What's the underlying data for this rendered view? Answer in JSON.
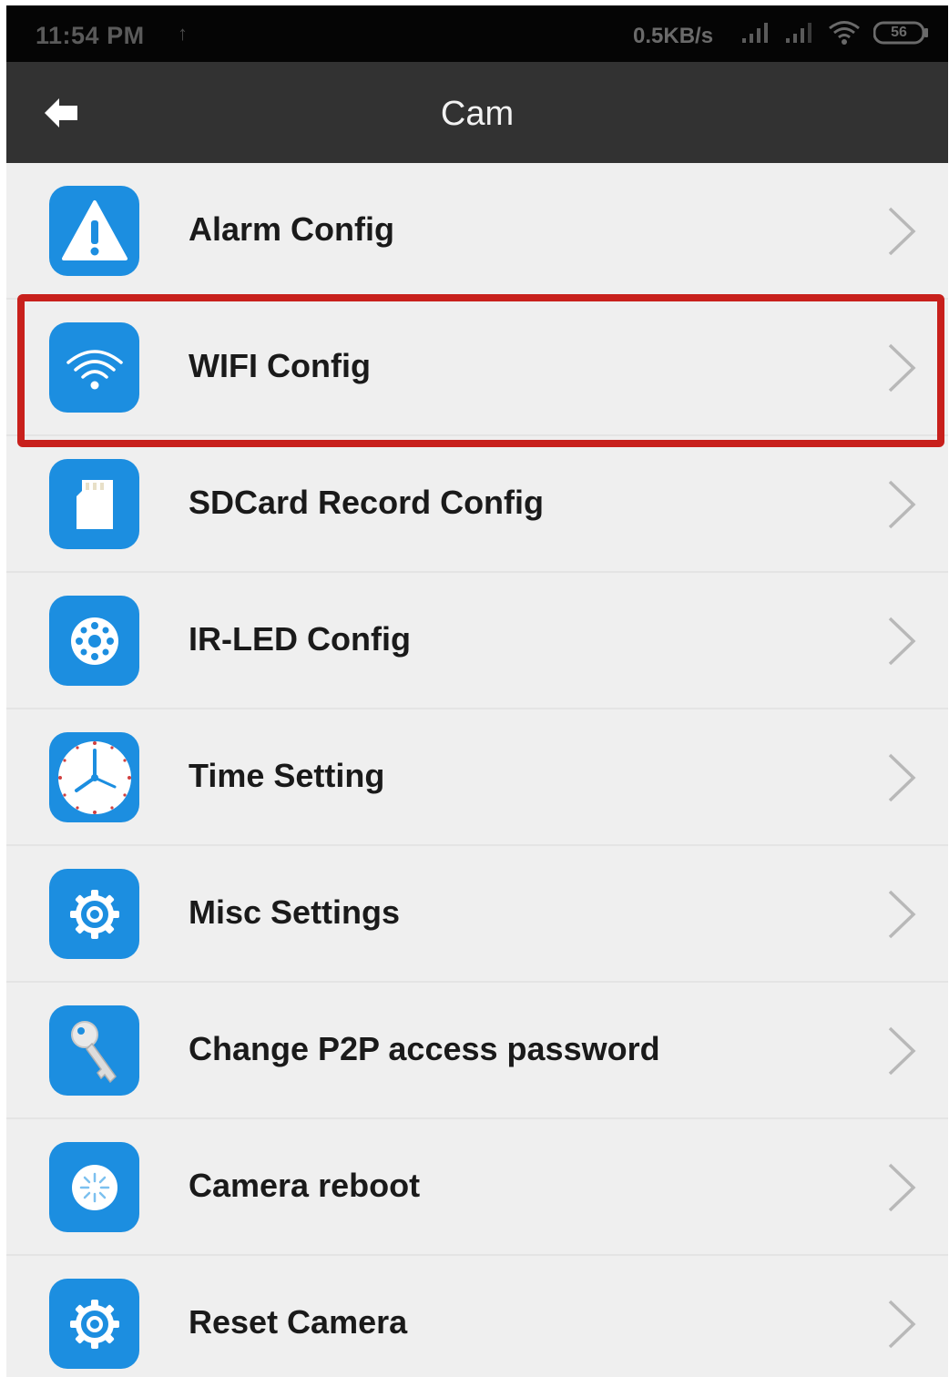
{
  "status_bar": {
    "time": "11:54 PM",
    "indicator": "↑",
    "network_speed": "0.5KB/s",
    "icons": [
      "signal-icon",
      "signal-icon",
      "wifi-icon",
      "battery-icon"
    ],
    "battery_level": "56"
  },
  "app_bar": {
    "back_icon": "back-arrow-icon",
    "title": "Cam"
  },
  "menu": {
    "items": [
      {
        "label": "Alarm Config",
        "icon": "warning-icon"
      },
      {
        "label": "WIFI Config",
        "icon": "wifi-icon",
        "highlighted": true
      },
      {
        "label": "SDCard Record Config",
        "icon": "sdcard-icon"
      },
      {
        "label": "IR-LED Config",
        "icon": "ir-led-icon"
      },
      {
        "label": "Time Setting",
        "icon": "clock-icon"
      },
      {
        "label": "Misc Settings",
        "icon": "gear-icon"
      },
      {
        "label": "Change P2P access password",
        "icon": "key-icon"
      },
      {
        "label": "Camera reboot",
        "icon": "reboot-icon"
      },
      {
        "label": "Reset Camera",
        "icon": "gear-icon"
      }
    ]
  },
  "colors": {
    "icon_blue": "#1c8ee0",
    "highlight_red": "#c8201c",
    "app_bar": "#323232",
    "status_bar": "#050505"
  }
}
